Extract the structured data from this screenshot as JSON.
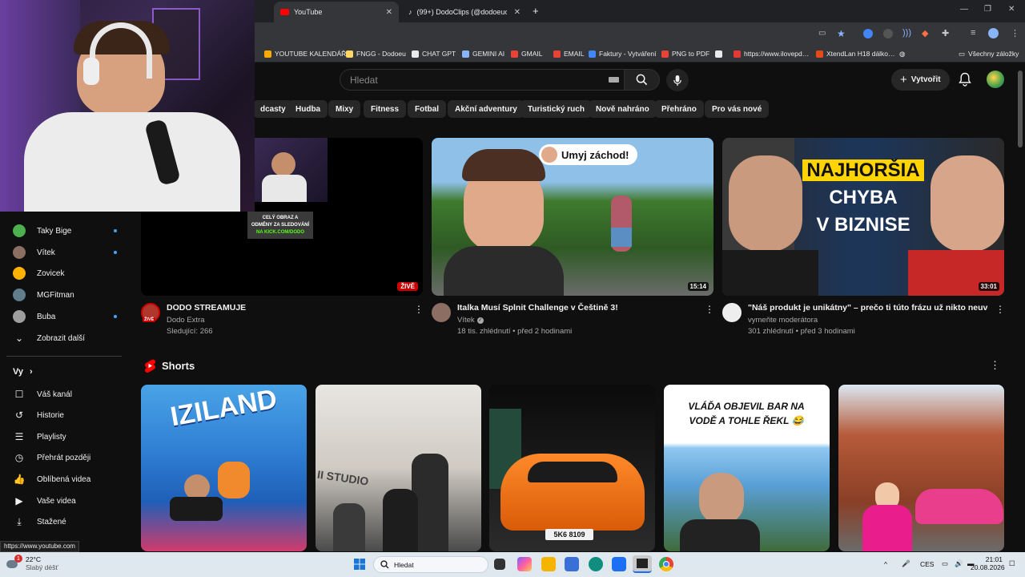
{
  "browser": {
    "tabs": [
      {
        "label": "YouTube"
      },
      {
        "label": "(99+) DodoClips (@dodoeuclip…"
      }
    ],
    "new_tab": "+",
    "bookmarks": [
      {
        "label": "YOUTUBE KALENDÁŘ",
        "color": "#f9ab00"
      },
      {
        "label": "FNGG - Dodoeu",
        "color": "#fdd663"
      },
      {
        "label": "CHAT GPT",
        "color": "#e8eaed"
      },
      {
        "label": "GEMINI AI",
        "color": "#8ab4f8"
      },
      {
        "label": "GMAIL",
        "color": "#ea4335"
      },
      {
        "label": "EMAIL",
        "color": "#ea4335"
      },
      {
        "label": "Faktury - Vytváření",
        "color": "#4285f4"
      },
      {
        "label": "PNG to PDF",
        "color": "#ea4335"
      },
      {
        "label": "",
        "color": "#e8eaed"
      },
      {
        "label": "https://www.ilovepd…",
        "color": "#e53935"
      },
      {
        "label": "XtendLan H18 dálko…",
        "color": "#e64a19"
      }
    ],
    "all_bookmarks": "Všechny záložky"
  },
  "header": {
    "search_placeholder": "Hledat",
    "create_label": "Vytvořit"
  },
  "chips": [
    "dcasty",
    "Hudba",
    "Mixy",
    "Fitness",
    "Fotbal",
    "Akční adventury",
    "Turistický ruch",
    "Nově nahráno",
    "Přehráno",
    "Pro vás nové"
  ],
  "sidebar": {
    "channels": [
      {
        "label": "Taky Bige",
        "color": "#4caf50",
        "dot": true
      },
      {
        "label": "Vítek",
        "color": "#8d6e63",
        "dot": true
      },
      {
        "label": "Zovicek",
        "color": "#ffb300",
        "dot": false
      },
      {
        "label": "MGFitman",
        "color": "#607d8b",
        "dot": false
      },
      {
        "label": "Buba",
        "color": "#9e9e9e",
        "dot": true
      }
    ],
    "show_more": "Zobrazit další",
    "you_heading": "Vy",
    "you_items": [
      {
        "label": "Váš kanál",
        "icon": "channel-icon",
        "glyph": "☐"
      },
      {
        "label": "Historie",
        "icon": "history-icon",
        "glyph": "↺"
      },
      {
        "label": "Playlisty",
        "icon": "playlist-icon",
        "glyph": "☰"
      },
      {
        "label": "Přehrát později",
        "icon": "clock-icon",
        "glyph": "◷"
      },
      {
        "label": "Oblíbená videa",
        "icon": "like-icon",
        "glyph": "👍"
      },
      {
        "label": "Vaše videa",
        "icon": "video-icon",
        "glyph": "▶"
      },
      {
        "label": "Stažené",
        "icon": "download-icon",
        "glyph": "⤓"
      }
    ]
  },
  "videos": [
    {
      "title": "DODO STREAMUJE",
      "channel": "Dodo Extra",
      "meta": "Sledující: 266",
      "badge": "ŽIVĚ",
      "avatar_badge": "ŽIVĚ"
    },
    {
      "title": "Italka Musí Splnit Challenge v Češtině 3!",
      "channel": "Vítek",
      "meta": "18 tis. zhlédnutí • před 2 hodinami",
      "duration": "15:14",
      "overlay": "Umyj záchod!"
    },
    {
      "title": "\"Náš produkt je unikátny\" – prečo ti túto frázu už nikto neuverí?",
      "channel": "vymeňte moderátora",
      "meta": "301 zhlédnutí • před 3 hodinami",
      "duration": "33:01",
      "overlay_lines": [
        "NAJHORŠIA",
        "CHYBA",
        "V BIZNISE"
      ]
    }
  ],
  "shorts": {
    "heading": "Shorts",
    "items": [
      {
        "text": "IZILAND"
      },
      {
        "text": "II STUDIO"
      },
      {
        "text": "5K6 8109"
      },
      {
        "text": "VLÁĎA OBJEVIL BAR NA VODĚ A TOHLE ŘEKL 😂"
      },
      {
        "text": ""
      }
    ]
  },
  "webcam": {
    "promo_lines": [
      "CELÝ OBRAZ A",
      "ODMĚNY ZA SLEDOVÁNÍ",
      "NA KICK.COM/DODO"
    ]
  },
  "status_url": "https://www.youtube.com",
  "taskbar": {
    "weather_temp": "22°C",
    "weather_desc": "Slabý déšť",
    "weather_badge": "1",
    "search": "Hledat",
    "lang": "CES",
    "time": "21:01",
    "date": "20.08.2026"
  }
}
